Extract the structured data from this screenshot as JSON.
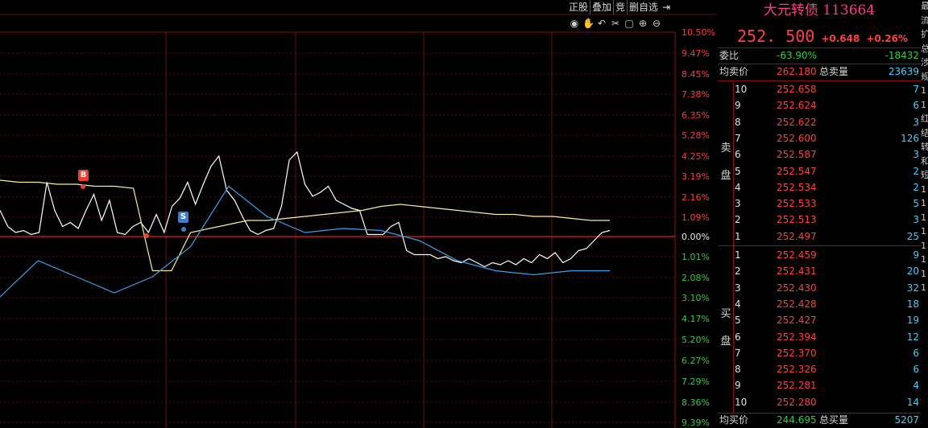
{
  "toolbar": {
    "buttons": [
      "正股",
      "叠加",
      "竞",
      "删自选"
    ],
    "icons": [
      "eye-icon",
      "hand-icon",
      "undo-icon",
      "scissors-icon",
      "lock-icon",
      "zoom-in-icon",
      "zoom-out-icon",
      "collapse-icon"
    ]
  },
  "chart_data": {
    "type": "line",
    "y_ticks_above": [
      "10.50%",
      "9.47%",
      "8.45%",
      "7.38%",
      "6.35%",
      "5.28%",
      "4.25%",
      "3.19%",
      "2.16%",
      "1.09%"
    ],
    "y_tick_zero": "0.00%",
    "y_ticks_below": [
      "1.01%",
      "2.08%",
      "3.10%",
      "4.17%",
      "5.20%",
      "6.27%",
      "7.29%",
      "8.36%",
      "9.39%"
    ],
    "markers": [
      {
        "label": "B",
        "color": "#e8402a"
      },
      {
        "label": "S",
        "color": "#3a7fc8"
      }
    ],
    "series": [
      {
        "name": "price",
        "color": "#ffffff",
        "values": [
          1.3,
          0.5,
          0.2,
          0.3,
          0.1,
          0.2,
          2.7,
          1.3,
          0.5,
          0.7,
          0.4,
          1.3,
          2.1,
          0.8,
          1.8,
          0.2,
          0.1,
          0.5,
          0.7,
          0.2,
          1.1,
          0.2,
          1.5,
          1.9,
          2.7,
          1.6,
          2.6,
          3.5,
          4.0,
          2.3,
          1.8,
          1.0,
          0.3,
          0.1,
          0.3,
          0.4,
          1.5,
          3.8,
          4.2,
          2.6,
          2.0,
          2.2,
          2.5,
          1.8,
          1.6,
          1.4,
          1.3,
          0.1,
          0.1,
          0.1,
          0.5,
          0.7,
          -0.7,
          -0.9,
          -0.9,
          -0.9,
          -1.1,
          -1.0,
          -1.2,
          -1.3,
          -1.1,
          -1.3,
          -1.5,
          -1.3,
          -1.4,
          -1.2,
          -1.4,
          -1.1,
          -1.3,
          -0.9,
          -1.1,
          -0.8,
          -1.3,
          -1.1,
          -0.7,
          -0.6,
          -0.2,
          0.2,
          0.3
        ],
        "color_note": "white price line"
      },
      {
        "name": "average",
        "color": "#f5f0a0",
        "values": [
          2.8,
          2.7,
          2.7,
          2.6,
          2.6,
          2.5,
          2.5,
          2.4,
          -1.7,
          -1.7,
          0.2,
          0.4,
          0.6,
          0.8,
          0.8,
          0.9,
          1.0,
          1.1,
          1.2,
          1.3,
          1.5,
          1.6,
          1.5,
          1.4,
          1.3,
          1.2,
          1.1,
          1.1,
          1.0,
          1.0,
          0.9,
          0.8,
          0.8
        ]
      },
      {
        "name": "benchmark",
        "color": "#3aa0e8",
        "values": [
          -3.0,
          -1.2,
          -2.0,
          -2.8,
          -2.0,
          -0.5,
          2.5,
          1.0,
          0.2,
          0.4,
          0.3,
          -0.2,
          -1.2,
          -1.7,
          -1.9,
          -1.7,
          -1.7
        ]
      }
    ]
  },
  "quote": {
    "name": "大元转债",
    "code": "113664",
    "price": "252. 500",
    "change": "+0.648",
    "change_pct": "+0.26%"
  },
  "info": {
    "weibi_label": "委比",
    "weibi_pct": "-63.90%",
    "weibi_diff": "-18432",
    "avg_sell_label": "均卖价",
    "avg_sell_price": "262.180",
    "total_sell_label": "总卖量",
    "total_sell_qty": "23639",
    "avg_buy_label": "均买价",
    "avg_buy_price": "244.695",
    "total_buy_label": "总买量",
    "total_buy_qty": "5207"
  },
  "sell_side_label": [
    "卖",
    "盘"
  ],
  "buy_side_label": [
    "买",
    "盘"
  ],
  "asks": [
    {
      "level": "10",
      "price": "252.658",
      "qty": "7"
    },
    {
      "level": "9",
      "price": "252.624",
      "qty": "6"
    },
    {
      "level": "8",
      "price": "252.622",
      "qty": "3"
    },
    {
      "level": "7",
      "price": "252.600",
      "qty": "126"
    },
    {
      "level": "6",
      "price": "252.587",
      "qty": "3"
    },
    {
      "level": "5",
      "price": "252.547",
      "qty": "2"
    },
    {
      "level": "4",
      "price": "252.534",
      "qty": "2"
    },
    {
      "level": "3",
      "price": "252.533",
      "qty": "5"
    },
    {
      "level": "2",
      "price": "252.513",
      "qty": "3"
    },
    {
      "level": "1",
      "price": "252.497",
      "qty": "25"
    }
  ],
  "bids": [
    {
      "level": "1",
      "price": "252.459",
      "qty": "9"
    },
    {
      "level": "2",
      "price": "252.431",
      "qty": "20"
    },
    {
      "level": "3",
      "price": "252.430",
      "qty": "32"
    },
    {
      "level": "4",
      "price": "252.428",
      "qty": "18"
    },
    {
      "level": "5",
      "price": "252.427",
      "qty": "19"
    },
    {
      "level": "6",
      "price": "252.394",
      "qty": "12"
    },
    {
      "level": "7",
      "price": "252.370",
      "qty": "6"
    },
    {
      "level": "8",
      "price": "252.326",
      "qty": "6"
    },
    {
      "level": "9",
      "price": "252.281",
      "qty": "4"
    },
    {
      "level": "10",
      "price": "252.280",
      "qty": "14"
    }
  ],
  "edge_strip": [
    "最",
    "流",
    "扩",
    "总",
    "涉",
    "规",
    "1",
    "1",
    "红",
    "结",
    "转",
    "和",
    "短",
    "1",
    "1",
    "1",
    "1",
    "1",
    "1",
    "1",
    "1"
  ]
}
